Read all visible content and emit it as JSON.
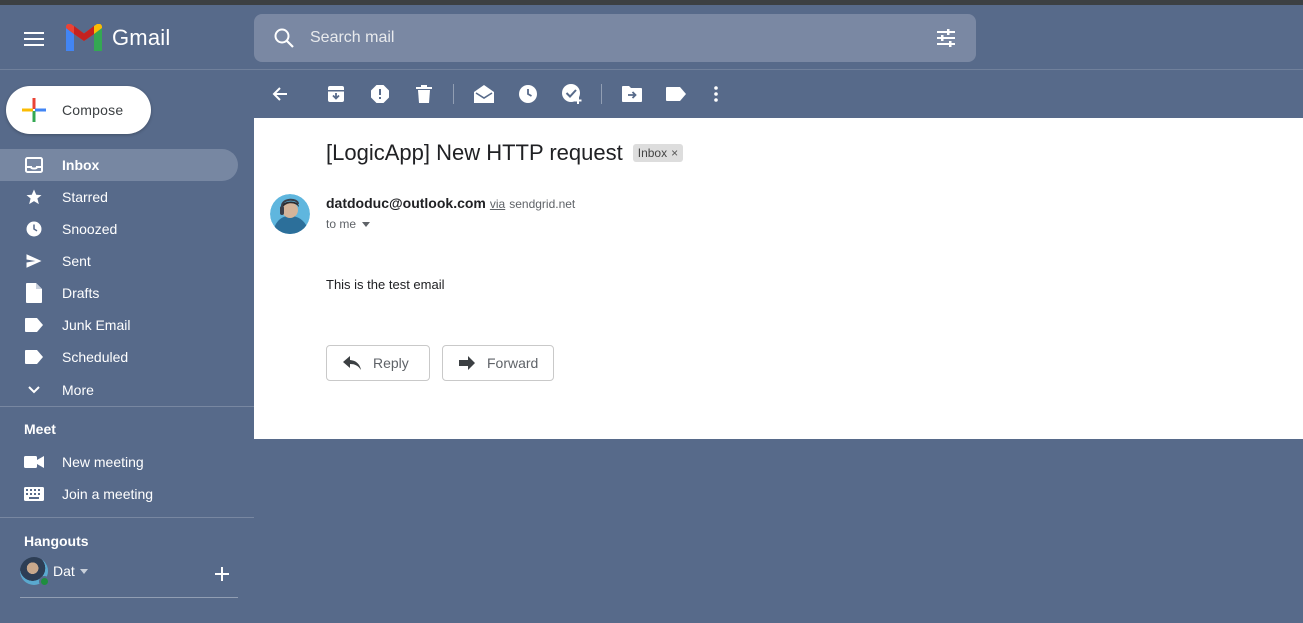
{
  "app": {
    "name": "Gmail"
  },
  "search": {
    "placeholder": "Search mail"
  },
  "compose": {
    "label": "Compose"
  },
  "sidebar": {
    "items": [
      {
        "label": "Inbox",
        "icon": "inbox-icon",
        "active": true
      },
      {
        "label": "Starred",
        "icon": "star-icon"
      },
      {
        "label": "Snoozed",
        "icon": "clock-icon"
      },
      {
        "label": "Sent",
        "icon": "send-icon"
      },
      {
        "label": "Drafts",
        "icon": "draft-icon"
      },
      {
        "label": "Junk Email",
        "icon": "label-icon"
      },
      {
        "label": "Scheduled",
        "icon": "label-icon"
      },
      {
        "label": "More",
        "icon": "chevron-down-icon"
      }
    ]
  },
  "meet": {
    "title": "Meet",
    "new_meeting": "New meeting",
    "join_meeting": "Join a meeting"
  },
  "hangouts": {
    "title": "Hangouts",
    "user": "Dat"
  },
  "message": {
    "subject": "[LogicApp] New HTTP request",
    "label": "Inbox",
    "sender_email": "datdoduc@outlook.com",
    "via": "via",
    "via_domain": "sendgrid.net",
    "to": "to me",
    "body": "This is the test email",
    "reply_label": "Reply",
    "forward_label": "Forward"
  },
  "colors": {
    "background": "#576a8a",
    "sidebar_active": "#7787a2",
    "search_bg": "#7a88a3",
    "pane": "#ffffff"
  }
}
